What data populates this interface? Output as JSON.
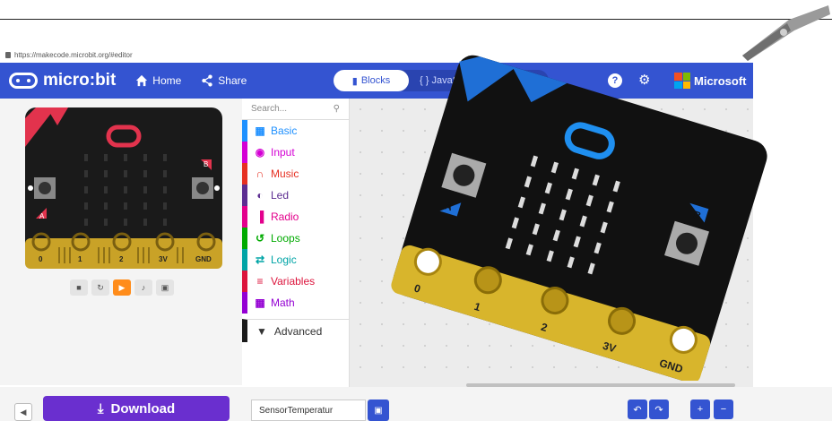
{
  "browser": {
    "url": "https://makecode.microbit.org/#editor"
  },
  "header": {
    "brand": "micro:bit",
    "home_label": "Home",
    "share_label": "Share",
    "blocks_label": "Blocks",
    "javascript_label": "{ } JavaScript",
    "help_symbol": "?",
    "vendor": "Microsoft",
    "color": "#3454d1"
  },
  "simulator": {
    "pins": [
      "0",
      "1",
      "2",
      "3V",
      "GND"
    ],
    "button_a": "A",
    "button_b": "B"
  },
  "toolbox": {
    "search_placeholder": "Search...",
    "categories": [
      {
        "label": "Basic",
        "color": "#1e90ff",
        "icon": "grid-icon"
      },
      {
        "label": "Input",
        "color": "#d400d4",
        "icon": "target-icon"
      },
      {
        "label": "Music",
        "color": "#e63022",
        "icon": "headphones-icon"
      },
      {
        "label": "Led",
        "color": "#5c2d91",
        "icon": "toggle-icon"
      },
      {
        "label": "Radio",
        "color": "#e3008c",
        "icon": "signal-icon"
      },
      {
        "label": "Loops",
        "color": "#00aa00",
        "icon": "loop-icon"
      },
      {
        "label": "Logic",
        "color": "#00a4a6",
        "icon": "shuffle-icon"
      },
      {
        "label": "Variables",
        "color": "#dc143c",
        "icon": "lines-icon"
      },
      {
        "label": "Math",
        "color": "#9400d3",
        "icon": "calculator-icon"
      }
    ],
    "advanced_label": "Advanced"
  },
  "footer": {
    "download_label": "Download",
    "project_name": "SensorTemperatur"
  }
}
